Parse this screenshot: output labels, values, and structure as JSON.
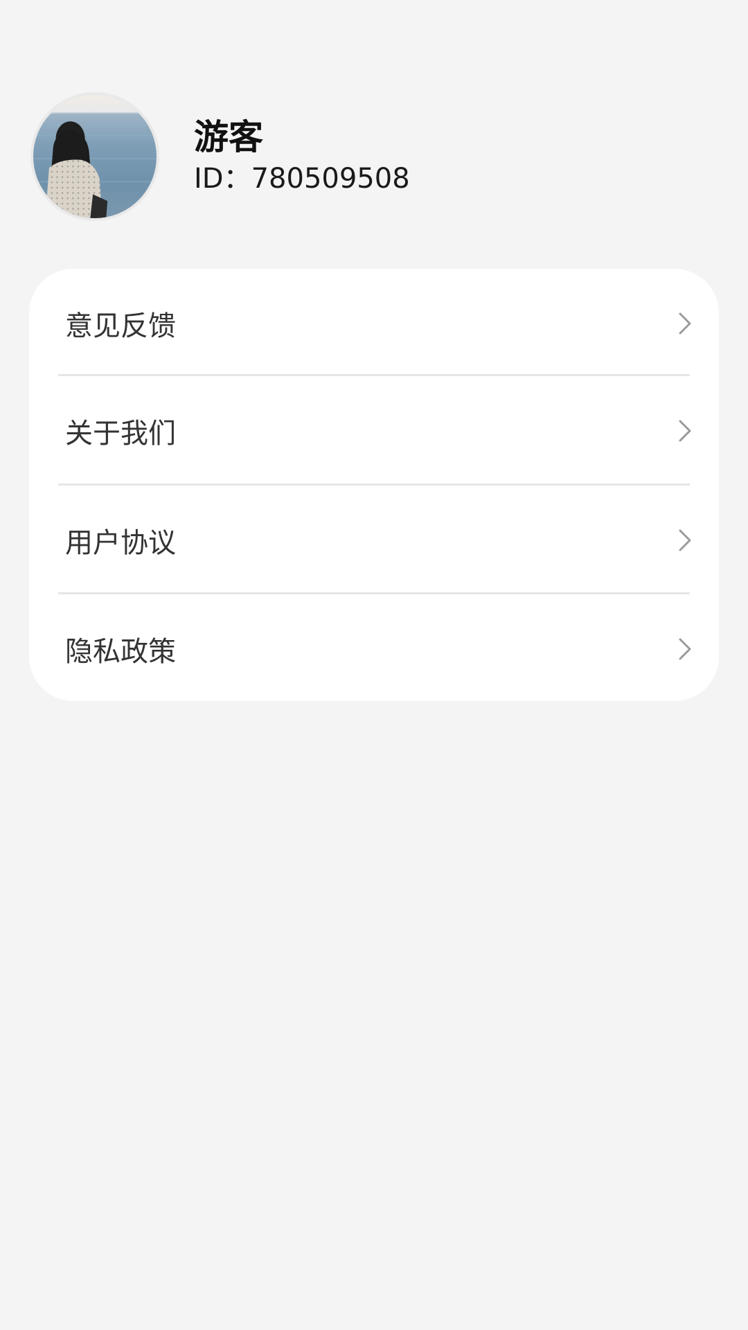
{
  "profile": {
    "name": "游客",
    "id_text": "ID：780509508"
  },
  "menu": {
    "items": [
      {
        "label": "意见反馈"
      },
      {
        "label": "关于我们"
      },
      {
        "label": "用户协议"
      },
      {
        "label": "隐私政策"
      }
    ]
  },
  "colors": {
    "background": "#f4f4f4",
    "card": "#ffffff",
    "divider": "#e6e6e6",
    "chevron": "#9a9a9a"
  },
  "icons": {
    "chevron": "chevron-right-icon"
  }
}
